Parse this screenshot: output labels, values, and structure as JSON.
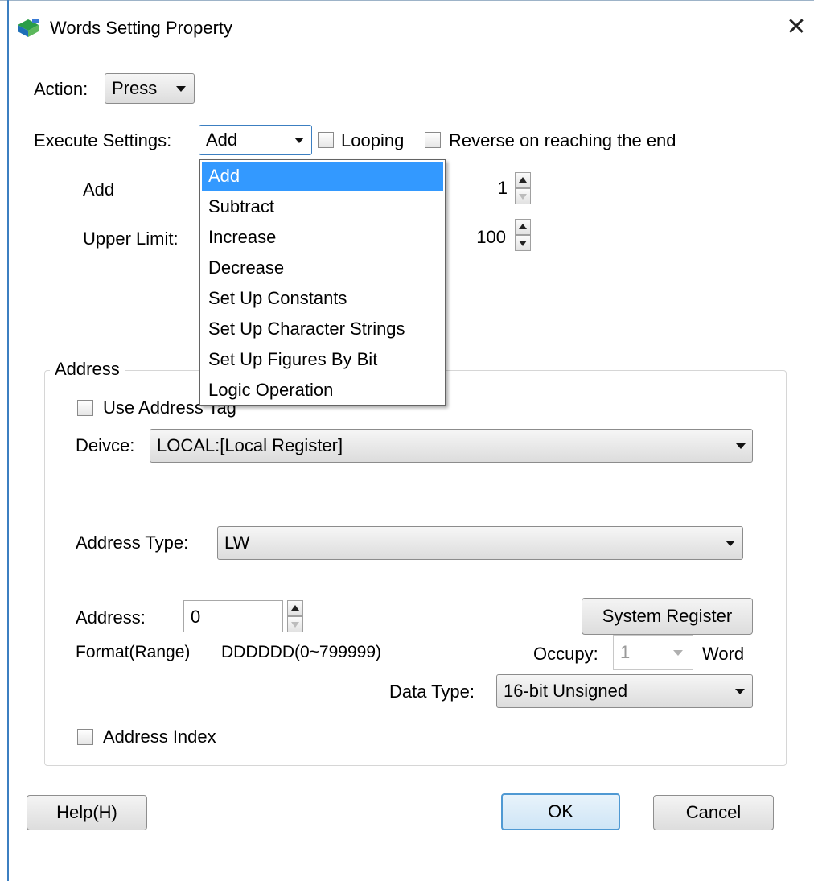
{
  "window": {
    "title": "Words Setting Property",
    "close_label": "✕"
  },
  "action": {
    "label": "Action:",
    "value": "Press"
  },
  "execute": {
    "label": "Execute Settings:",
    "value": "Add",
    "looping_label": "Looping",
    "reverse_label": "Reverse on reaching the end",
    "looping_checked": false,
    "reverse_checked": false
  },
  "add_row": {
    "label": "Add",
    "value": "1"
  },
  "upper_row": {
    "label": "Upper Limit:",
    "value": "100"
  },
  "dropdown": {
    "items": [
      {
        "label": "Add",
        "selected": true
      },
      {
        "label": "Subtract"
      },
      {
        "label": "Increase"
      },
      {
        "label": "Decrease"
      },
      {
        "label": "Set Up Constants"
      },
      {
        "label": "Set Up Character Strings"
      },
      {
        "label": "Set Up Figures By Bit"
      },
      {
        "label": "Logic Operation"
      }
    ]
  },
  "address_group": {
    "title": "Address",
    "use_tag_label": "Use Address Tag",
    "device_label": "Deivce:",
    "device_value": "LOCAL:[Local Register]",
    "type_label": "Address Type:",
    "type_value": "LW",
    "address_label": "Address:",
    "address_value": "0",
    "system_register_label": "System Register",
    "format_label": "Format(Range)",
    "format_value": "DDDDDD(0~799999)",
    "occupy_label": "Occupy:",
    "occupy_value": "1",
    "occupy_unit": "Word",
    "data_type_label": "Data Type:",
    "data_type_value": "16-bit Unsigned",
    "index_label": "Address Index"
  },
  "buttons": {
    "help": "Help(H)",
    "ok": "OK",
    "cancel": "Cancel"
  },
  "colors": {
    "accent": "#3399ff",
    "window_border": "#3c7fc1",
    "default_button_border": "#4f99d3"
  }
}
